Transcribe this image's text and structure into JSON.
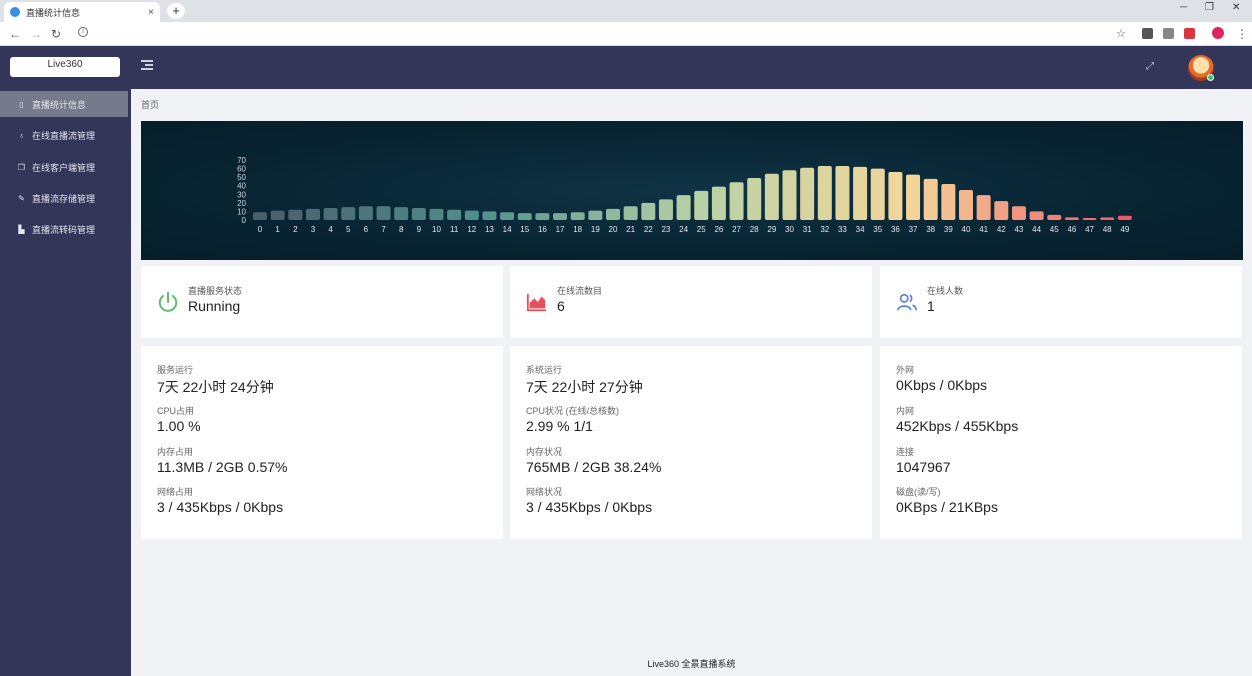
{
  "browser": {
    "tab_title": "直播统计信息",
    "tab_close": "×",
    "new_tab": "+",
    "win_min": "─",
    "win_max": "❐",
    "win_close": "✕"
  },
  "header": {
    "logo": "Live360"
  },
  "sidebar": {
    "items": [
      {
        "label": "直播统计信息",
        "icon": "phone-icon"
      },
      {
        "label": "在线直播流管理",
        "icon": "mic-icon"
      },
      {
        "label": "在线客户端管理",
        "icon": "copy-icon"
      },
      {
        "label": "直播流存储管理",
        "icon": "edit-icon"
      },
      {
        "label": "直播流转码管理",
        "icon": "chart-icon"
      }
    ]
  },
  "breadcrumb": "首页",
  "chart_data": {
    "type": "bar",
    "categories": [
      "0",
      "1",
      "2",
      "3",
      "4",
      "5",
      "6",
      "7",
      "8",
      "9",
      "10",
      "11",
      "12",
      "13",
      "14",
      "15",
      "16",
      "17",
      "18",
      "19",
      "20",
      "21",
      "22",
      "23",
      "24",
      "25",
      "26",
      "27",
      "28",
      "29",
      "30",
      "31",
      "32",
      "33",
      "34",
      "35",
      "36",
      "37",
      "38",
      "39",
      "40",
      "41",
      "42",
      "43",
      "44",
      "45",
      "46",
      "47",
      "48",
      "49"
    ],
    "values": [
      9,
      11,
      12,
      13,
      14,
      15,
      16,
      16,
      15,
      14,
      13,
      12,
      11,
      10,
      9,
      8,
      8,
      8,
      9,
      11,
      13,
      16,
      20,
      24,
      29,
      34,
      39,
      44,
      49,
      54,
      58,
      61,
      63,
      63,
      62,
      60,
      56,
      53,
      48,
      42,
      35,
      29,
      22,
      16,
      10,
      6,
      3,
      2,
      3,
      5
    ],
    "ylim": [
      0,
      70
    ],
    "yticks": [
      "70",
      "60",
      "50",
      "40",
      "30",
      "20",
      "10",
      "0"
    ],
    "grid": false,
    "colors": {
      "start": "#4a5e6b",
      "mid1": "#4f8f8c",
      "mid2": "#b7d1a6",
      "mid3": "#f3d79a",
      "end": "#ee5868"
    }
  },
  "stats": {
    "service": {
      "label": "直播服务状态",
      "value": "Running",
      "icon": "power-icon",
      "color": "#5fbf6f"
    },
    "streams": {
      "label": "在线流数目",
      "value": "6",
      "icon": "area-chart-icon",
      "color": "#e8505b"
    },
    "users": {
      "label": "在线人数",
      "value": "1",
      "icon": "users-icon",
      "color": "#5a7de0"
    }
  },
  "panels": {
    "left": [
      {
        "label": "服务运行",
        "value": "7天 22小时 24分钟"
      },
      {
        "label": "CPU占用",
        "value": "1.00 %"
      },
      {
        "label": "内存占用",
        "value": "11.3MB / 2GB 0.57%"
      },
      {
        "label": "网络占用",
        "value": "3 / 435Kbps / 0Kbps"
      }
    ],
    "middle": [
      {
        "label": "系统运行",
        "value": "7天 22小时 27分钟"
      },
      {
        "label": "CPU状况 (在线/总核数)",
        "value": "2.99 % 1/1"
      },
      {
        "label": "内存状况",
        "value": "765MB / 2GB 38.24%"
      },
      {
        "label": "网络状况",
        "value": "3 / 435Kbps / 0Kbps"
      }
    ],
    "right": [
      {
        "label": "外网",
        "value": "0Kbps / 0Kbps"
      },
      {
        "label": "内网",
        "value": "452Kbps / 455Kbps"
      },
      {
        "label": "连接",
        "value": "1047967"
      },
      {
        "label": "磁盘(读/写)",
        "value": "0KBps / 21KBps"
      }
    ]
  },
  "footer": "Live360 全景直播系统"
}
